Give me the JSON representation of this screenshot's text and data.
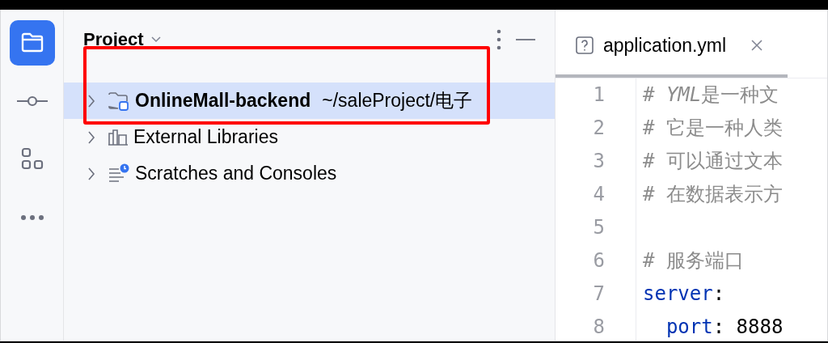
{
  "tool_strip": [
    {
      "kind": "project",
      "selected": true
    },
    {
      "kind": "commit",
      "selected": false
    },
    {
      "kind": "structure",
      "selected": false
    },
    {
      "kind": "more",
      "selected": false
    }
  ],
  "project_panel": {
    "title": "Project",
    "tree": [
      {
        "kind": "module",
        "name": "OnlineMall-backend",
        "path": "~/saleProject/电子",
        "selected": true,
        "expanded": false
      },
      {
        "kind": "libraries",
        "name": "External Libraries",
        "selected": false,
        "expanded": false
      },
      {
        "kind": "scratches",
        "name": "Scratches and Consoles",
        "selected": false,
        "expanded": false
      }
    ]
  },
  "editor": {
    "tabs": [
      {
        "label": "application.yml",
        "selected": true
      }
    ],
    "lines": [
      {
        "number": "1",
        "tokens": [
          {
            "kind": "comment",
            "text": "# "
          },
          {
            "kind": "comment_italic",
            "text": "YML"
          },
          {
            "kind": "comment",
            "text": "是一种文"
          }
        ]
      },
      {
        "number": "2",
        "tokens": [
          {
            "kind": "comment",
            "text": "# 它是一种人类"
          }
        ]
      },
      {
        "number": "3",
        "tokens": [
          {
            "kind": "comment",
            "text": "# 可以通过文本"
          }
        ]
      },
      {
        "number": "4",
        "tokens": [
          {
            "kind": "comment",
            "text": "# 在数据表示方"
          }
        ]
      },
      {
        "number": "5"
      },
      {
        "number": "6",
        "tokens": [
          {
            "kind": "comment",
            "text": "# 服务端口"
          }
        ]
      },
      {
        "number": "7",
        "tokens": [
          {
            "kind": "key",
            "text": "server"
          },
          {
            "kind": "punct",
            "text": ":"
          }
        ]
      },
      {
        "number": "8",
        "tokens": [
          {
            "kind": "key",
            "text": "  port"
          },
          {
            "kind": "punct",
            "text": ": "
          },
          {
            "kind": "value",
            "text": "8888"
          }
        ]
      }
    ]
  }
}
